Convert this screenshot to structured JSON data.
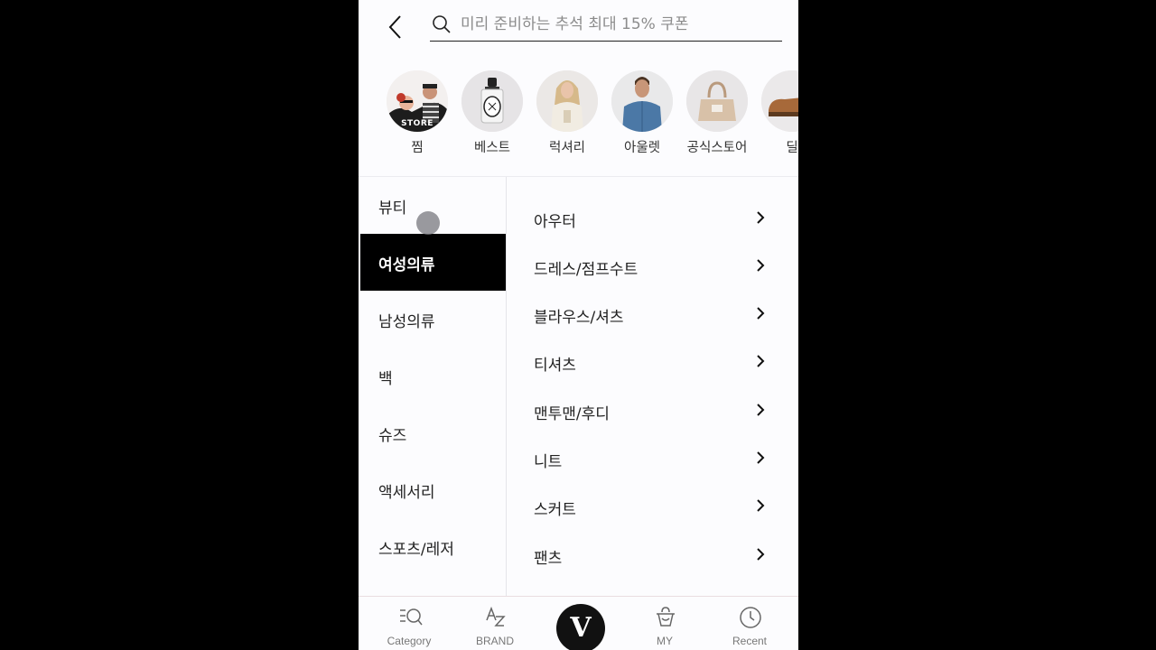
{
  "header": {
    "search_placeholder": "미리 준비하는 추석 최대 15% 쿠폰"
  },
  "stories": [
    {
      "label": "찜",
      "tag": "STORE",
      "icon": "people-photo"
    },
    {
      "label": "베스트",
      "icon": "perfume-bottle-photo"
    },
    {
      "label": "럭셔리",
      "icon": "woman-model-photo"
    },
    {
      "label": "아울렛",
      "icon": "man-model-photo"
    },
    {
      "label": "공식스토어",
      "icon": "handbag-photo"
    },
    {
      "label": "딜",
      "icon": "shoe-photo"
    }
  ],
  "main_categories": [
    {
      "label": "뷰티"
    },
    {
      "label": "여성의류",
      "active": true
    },
    {
      "label": "남성의류"
    },
    {
      "label": "백"
    },
    {
      "label": "슈즈"
    },
    {
      "label": "액세서리"
    },
    {
      "label": "스포츠/레저"
    }
  ],
  "sub_categories": [
    {
      "label": "아우터"
    },
    {
      "label": "드레스/점프수트"
    },
    {
      "label": "블라우스/셔츠"
    },
    {
      "label": "티셔츠"
    },
    {
      "label": "맨투맨/후디"
    },
    {
      "label": "니트"
    },
    {
      "label": "스커트"
    },
    {
      "label": "팬츠"
    }
  ],
  "bottom_nav": {
    "category": "Category",
    "brand": "BRAND",
    "home": "V",
    "my": "MY",
    "recent": "Recent"
  }
}
